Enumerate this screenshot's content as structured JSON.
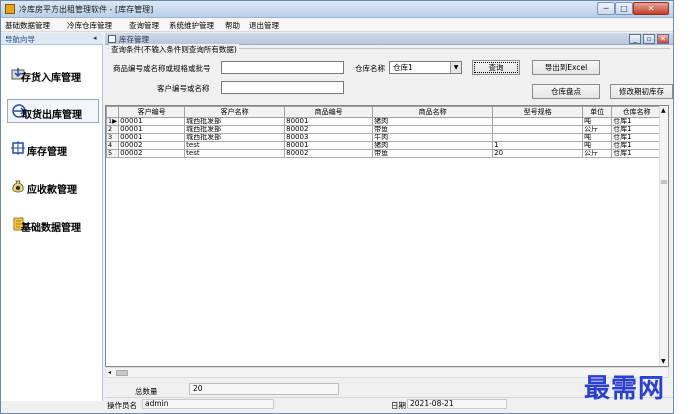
{
  "window": {
    "title": "冷库房平方出租管理软件 - [库存管理]",
    "min_glyph": "─",
    "max_glyph": "□",
    "close_glyph": "✕"
  },
  "menu": [
    "基础数据管理",
    "冷库仓库管理",
    "查询管理",
    "系统维护管理",
    "帮助",
    "退出管理"
  ],
  "nav": {
    "title": "导航向导",
    "pin": "◂",
    "items": [
      {
        "label": "存货入库管理",
        "icon": "inbound-icon"
      },
      {
        "label": "取货出库管理",
        "icon": "outbound-icon"
      },
      {
        "label": "库存管理",
        "icon": "inventory-icon"
      },
      {
        "label": "应收款管理",
        "icon": "money-bag-icon"
      },
      {
        "label": "基础数据管理",
        "icon": "document-icon"
      }
    ]
  },
  "child_window": {
    "title": "库存管理",
    "btn_min": "_",
    "btn_restore": "▫",
    "btn_close": "✕"
  },
  "filter": {
    "group_label": "查询条件(不输入条件则查询所有数据)",
    "product_label": "商品编号或名称或规格或批号",
    "product_value": "",
    "warehouse_label": "仓库名称",
    "warehouse_value": "仓库1",
    "customer_label": "客户编号或名称",
    "customer_value": "",
    "query_btn": "查询",
    "export_btn": "导出到Excel",
    "inventory_btn": "仓库盘点",
    "modify_btn": "修改期初库存"
  },
  "table": {
    "columns": [
      "客户编号",
      "客户名称",
      "商品编号",
      "商品名称",
      "型号规格",
      "单位",
      "仓库名称"
    ],
    "rows": [
      {
        "n": "1",
        "marker": "▶",
        "cells": [
          "00001",
          "城西批发部",
          "80001",
          "猪肉",
          "",
          "吨",
          "仓库1"
        ]
      },
      {
        "n": "2",
        "marker": "",
        "cells": [
          "00001",
          "城西批发部",
          "80002",
          "带鱼",
          "",
          "公斤",
          "仓库1"
        ]
      },
      {
        "n": "3",
        "marker": "",
        "cells": [
          "00001",
          "城西批发部",
          "80003",
          "牛肉",
          "",
          "吨",
          "仓库1"
        ]
      },
      {
        "n": "4",
        "marker": "",
        "cells": [
          "00002",
          "test",
          "80001",
          "猪肉",
          "1",
          "吨",
          "仓库1"
        ]
      },
      {
        "n": "5",
        "marker": "",
        "cells": [
          "00002",
          "test",
          "80002",
          "带鱼",
          "20",
          "公斤",
          "仓库1"
        ]
      }
    ]
  },
  "totals": {
    "label": "总数量",
    "value": "20"
  },
  "status": {
    "operator_label": "操作员名",
    "operator_value": "admin",
    "date_label": "日期",
    "date_value": "2021-08-21"
  },
  "watermark": "最需网"
}
